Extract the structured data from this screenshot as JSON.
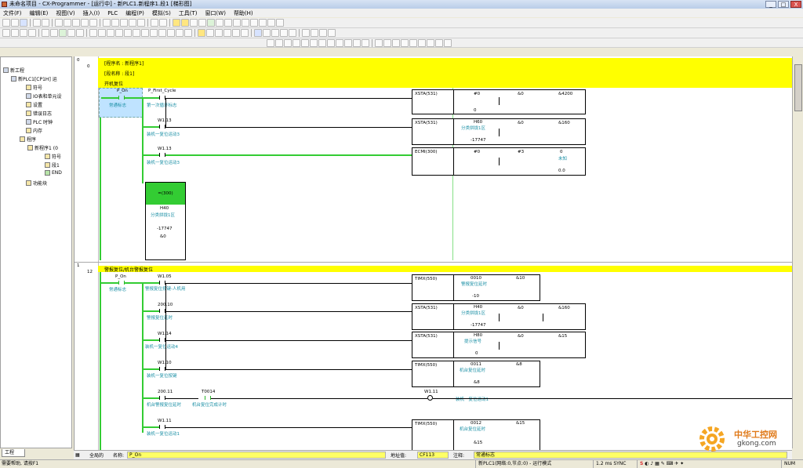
{
  "window": {
    "title": "未命名项目 - CX-Programmer - [运行中] - 新PLC1.新程序1.段1 [梯形图]",
    "buttons": [
      "_",
      "□",
      "X"
    ]
  },
  "menu": [
    "文件(F)",
    "编辑(E)",
    "视图(V)",
    "插入(I)",
    "PLC",
    "编程(P)",
    "模拟(S)",
    "工具(T)",
    "窗口(W)",
    "帮助(H)"
  ],
  "tree": {
    "items": [
      {
        "label": "新工程"
      },
      {
        "label": "新PLC1[CP1H] 运"
      },
      {
        "label": "符号"
      },
      {
        "label": "IO表和单元设"
      },
      {
        "label": "设置"
      },
      {
        "label": "错误日志"
      },
      {
        "label": "PLC 时钟"
      },
      {
        "label": "内存"
      },
      {
        "label": "程序"
      },
      {
        "label": "新程序1 (0"
      },
      {
        "label": "符号"
      },
      {
        "label": "段1"
      },
      {
        "label": "END"
      },
      {
        "label": "功能块"
      }
    ],
    "tab": "工程"
  },
  "ladder": {
    "rung0": {
      "num_a": "0",
      "num_b": "0",
      "header1": "[程序名 : 新程序1]",
      "header2": "[段名称 : 段1]",
      "header3": "开机复位",
      "contact1": {
        "addr": "P_On",
        "comment": "常通标志"
      },
      "contact2": {
        "addr": "P_First_Cycle",
        "comment": "第一次循环标志"
      },
      "contact3": {
        "addr": "W1.13",
        "comment": "装机一复位运动3"
      },
      "contact4": {
        "addr": "W1.13",
        "comment": "装机一复位运动3"
      },
      "out_block": {
        "title": "=(300)",
        "op1": "H40",
        "op2": "分类拼拢1区",
        "op3": "-17747",
        "op4": "&0"
      },
      "blocks": [
        {
          "name": "XSTA(531)",
          "a": "#0",
          "b": "&0",
          "c": "&4200",
          "d": "0"
        },
        {
          "name": "XSTA(531)",
          "a": "H60",
          "b": "分类拼拢1区",
          "c": "&0",
          "d": "&160",
          "e": "-17747"
        },
        {
          "name": "ECMI(300)",
          "a": "#0",
          "b": "#3",
          "c": "0",
          "d": "未知",
          "e": "0.0"
        }
      ]
    },
    "rung1": {
      "num_a": "1",
      "num_b": "12",
      "header": "警报复位/机台警报复位",
      "contact1": {
        "addr": "P_On",
        "comment": "常通标志"
      },
      "contacts": [
        {
          "addr": "W1.05",
          "comment": "警报复位按键-人机用"
        },
        {
          "addr": "200.10",
          "comment": "警报复位延时"
        },
        {
          "addr": "W1.14",
          "comment": "装机一复位运动4"
        },
        {
          "addr": "W1.10",
          "comment": "装机一复位按键"
        },
        {
          "addr": "200.11",
          "comment": "机台警报复位延时"
        },
        {
          "addr": "W1.11",
          "comment": "装机一复位运动1"
        }
      ],
      "contact_g": {
        "addr": "T0014",
        "comment": "机台复位完成计时"
      },
      "coil": {
        "addr": "W1.11",
        "comment": "装机一复位运动1"
      },
      "blocks": [
        {
          "name": "TIMX(550)",
          "a": "0010",
          "b": "&10",
          "c": "警报复位延时",
          "d": "-10"
        },
        {
          "name": "XSTA(531)",
          "a": "H40",
          "b": "&0",
          "c": "&160",
          "d": "分类拼拢1区",
          "e": "-17747"
        },
        {
          "name": "XSTA(531)",
          "a": "H80",
          "b": "&0",
          "c": "&15",
          "d": "提示信号",
          "e": "0"
        },
        {
          "name": "TIMX(550)",
          "a": "0011",
          "b": "&8",
          "c": "机台复位延时",
          "d": "&8"
        },
        {
          "name": "TIMX(550)",
          "a": "0012",
          "b": "&15",
          "c": "机台复位延时",
          "d": "&15"
        }
      ]
    }
  },
  "watch": {
    "label1": "全局的",
    "label2": "名称:",
    "name_value": "P_On",
    "addr_label": "地址值:",
    "addr_value": "CF113",
    "comment_label": "注释:",
    "comment_value": "常通标志"
  },
  "status": {
    "left": "需要帮助, 请按F1",
    "mid": "新PLC1(网络:0,节点:0) - 运行模式",
    "cycle": "1.2 ms SYNC",
    "num": "NUM"
  },
  "watermark": {
    "text_cn": "中华工控网",
    "text_en": "gkong.com"
  }
}
